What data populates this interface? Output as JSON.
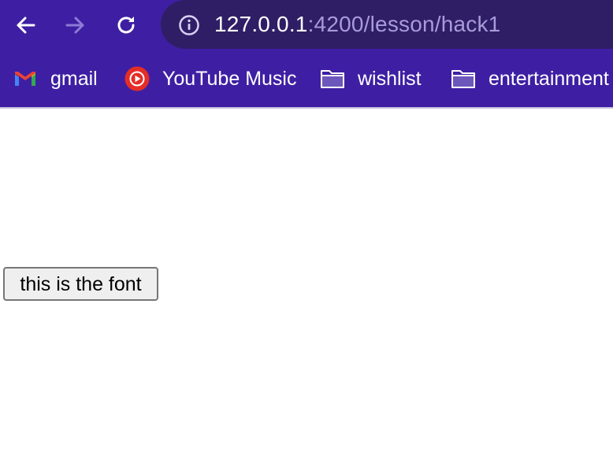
{
  "browser": {
    "address_bar": {
      "host": "127.0.0.1",
      "path": ":4200/lesson/hack1"
    },
    "bookmarks": [
      {
        "label": "gmail",
        "icon": "gmail-icon"
      },
      {
        "label": "YouTube Music",
        "icon": "youtube-music-icon"
      },
      {
        "label": "wishlist",
        "icon": "folder-icon"
      },
      {
        "label": "entertainment",
        "icon": "folder-icon"
      }
    ],
    "nav": {
      "back_icon": "arrow-left-icon",
      "forward_icon": "arrow-right-icon",
      "reload_icon": "reload-icon",
      "info_icon": "info-icon"
    }
  },
  "page": {
    "button_label": "this is the font"
  },
  "colors": {
    "chrome": "#3e1fa3",
    "omnibox": "#2f1e66",
    "url_path": "#a99bd9",
    "youtube_red": "#e52d27"
  }
}
